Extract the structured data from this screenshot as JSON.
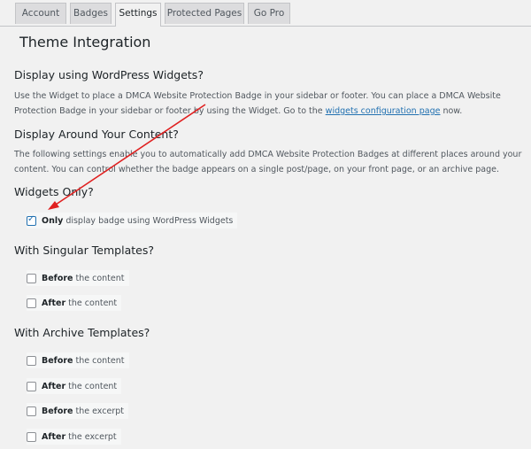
{
  "tabs": [
    {
      "label": "Account"
    },
    {
      "label": "Badges"
    },
    {
      "label": "Settings",
      "active": true
    },
    {
      "label": "Protected Pages"
    },
    {
      "label": "Go Pro"
    }
  ],
  "page_title": "Theme Integration",
  "sections": {
    "widgets": {
      "heading": "Display using WordPress Widgets?",
      "text_before_link": "Use the Widget to place a DMCA Website Protection Badge in your sidebar or footer. You can place a DMCA Website Protection Badge in your sidebar or footer by using the Widget. Go to the ",
      "link": "widgets configuration page",
      "text_after_link": " now."
    },
    "around": {
      "heading": "Display Around Your Content?",
      "text": "The following settings enable you to automatically add DMCA Website Protection Badges at different places around your content. You can control whether the badge appears on a single post/page, on your front page, or an archive page."
    },
    "widgets_only": {
      "heading": "Widgets Only?",
      "options": [
        {
          "bold": "Only",
          "rest": " display badge using WordPress Widgets",
          "checked": true
        }
      ]
    },
    "singular": {
      "heading": "With Singular Templates?",
      "options": [
        {
          "bold": "Before",
          "rest": " the content",
          "checked": false
        },
        {
          "bold": "After",
          "rest": " the content",
          "checked": false
        }
      ]
    },
    "archive": {
      "heading": "With Archive Templates?",
      "options": [
        {
          "bold": "Before",
          "rest": " the content",
          "checked": false
        },
        {
          "bold": "After",
          "rest": " the content",
          "checked": false
        },
        {
          "bold": "Before",
          "rest": " the excerpt",
          "checked": false
        },
        {
          "bold": "After",
          "rest": " the excerpt",
          "checked": false
        }
      ]
    }
  },
  "colors": {
    "annotation_arrow": "#e02020",
    "link": "#2271b1"
  }
}
